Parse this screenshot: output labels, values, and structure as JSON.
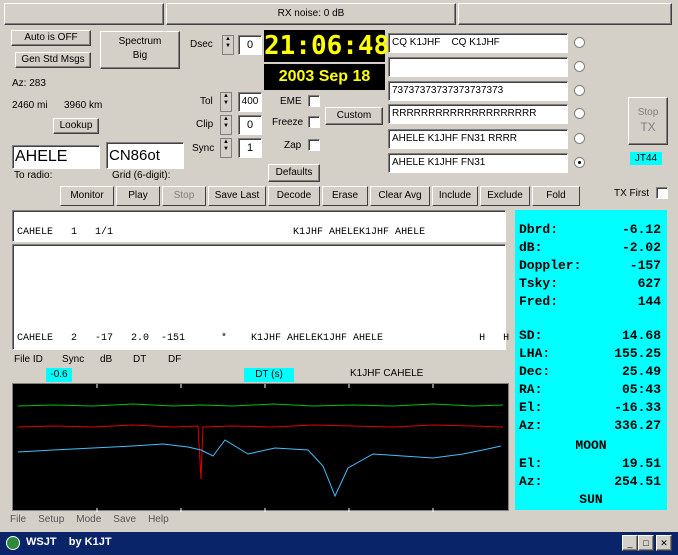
{
  "status_bar": {
    "rx_noise": "RX noise: 0 dB"
  },
  "buttons": {
    "auto": "Auto is OFF",
    "gen_std": "Gen Std Msgs",
    "spectrum": "Spectrum",
    "big": "Big",
    "lookup": "Lookup",
    "custom": "Custom",
    "defaults": "Defaults",
    "tx_stop_line1": "Stop",
    "tx_stop_line2": "TX"
  },
  "info": {
    "az": "Az: 283",
    "dist_mi": "2460 mi",
    "dist_km": "3960 km",
    "to_radio": "To radio:",
    "grid": "Grid (6-digit):"
  },
  "inputs": {
    "callsign": "AHELE",
    "grid": "CN86ot"
  },
  "controls": {
    "dsec_label": "Dsec",
    "dsec_value": "0",
    "tol_label": "Tol",
    "tol_value": "400",
    "clip_label": "Clip",
    "clip_value": "0",
    "sync_label": "Sync",
    "sync_value": "1",
    "eme_label": "EME",
    "freeze_label": "Freeze",
    "zap_label": "Zap"
  },
  "clock": {
    "time": "21:06:48",
    "date": "2003 Sep 18"
  },
  "messages": [
    "CQ K1JHF    CQ K1JHF",
    "",
    "73737373737373737373",
    "RRRRRRRRRRRRRRRRRRRR",
    "AHELE K1JHF FN31 RRRR",
    "AHELE K1JHF FN31"
  ],
  "mode_badge": "JT44",
  "tx_first": "TX First",
  "tabs": [
    "Monitor",
    "Play",
    "Stop",
    "Save Last",
    "Decode",
    "Erase",
    "Clear Avg",
    "Include",
    "Exclude",
    "Fold"
  ],
  "decode": {
    "top_line": "CAHELE   1   1/1                              K1JHF AHELEK1JHF AHELE",
    "bottom_line": "CAHELE   2   -17   2.0  -151      *    K1JHF AHELEK1JHF AHELE                H   H",
    "columns": [
      "File ID",
      "Sync",
      "dB",
      "DT",
      "DF"
    ]
  },
  "markers": {
    "left": "-0.6",
    "dt": "DT (s)",
    "msg": "K1JHF CAHELE"
  },
  "right_panel": {
    "top": [
      {
        "k": "Dbrd:",
        "v": "-6.12"
      },
      {
        "k": "dB:",
        "v": "-2.02"
      },
      {
        "k": "Doppler:",
        "v": "-157"
      },
      {
        "k": "Tsky:",
        "v": "627"
      },
      {
        "k": "Fred:",
        "v": "144"
      }
    ],
    "moon": [
      {
        "k": "SD:",
        "v": "14.68"
      },
      {
        "k": "LHA:",
        "v": "155.25"
      },
      {
        "k": "Dec:",
        "v": "25.49"
      },
      {
        "k": "RA:",
        "v": "05:43"
      },
      {
        "k": "El:",
        "v": "-16.33"
      },
      {
        "k": "Az:",
        "v": "336.27"
      }
    ],
    "moon_label": "MOON",
    "sun": [
      {
        "k": "El:",
        "v": "19.51"
      },
      {
        "k": "Az:",
        "v": "254.51"
      }
    ],
    "sun_label": "SUN"
  },
  "menu": [
    "File",
    "Setup",
    "Mode",
    "Save",
    "Help"
  ],
  "title": "WSJT    by K1JT",
  "colors": {
    "cyan": "#00ffff",
    "clock_bg": "#000000",
    "clock_fg": "#ffff00",
    "plot_bg": "#000000",
    "green": "#00c000",
    "red": "#e00000",
    "lightblue": "#40c0ff"
  }
}
